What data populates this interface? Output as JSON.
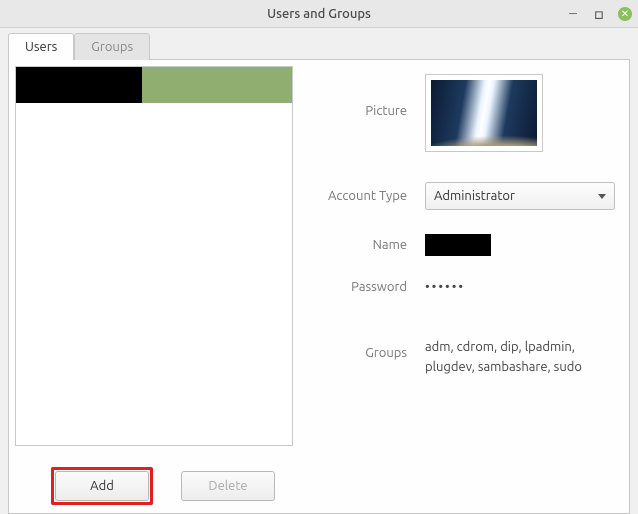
{
  "window": {
    "title": "Users and Groups"
  },
  "tabs": {
    "users": "Users",
    "groups": "Groups"
  },
  "details": {
    "picture_label": "Picture",
    "account_type_label": "Account Type",
    "account_type_value": "Administrator",
    "name_label": "Name",
    "password_label": "Password",
    "password_value": "••••••",
    "groups_label": "Groups",
    "groups_value": "adm, cdrom, dip, lpadmin, plugdev, sambashare, sudo"
  },
  "buttons": {
    "add": "Add",
    "delete": "Delete"
  }
}
